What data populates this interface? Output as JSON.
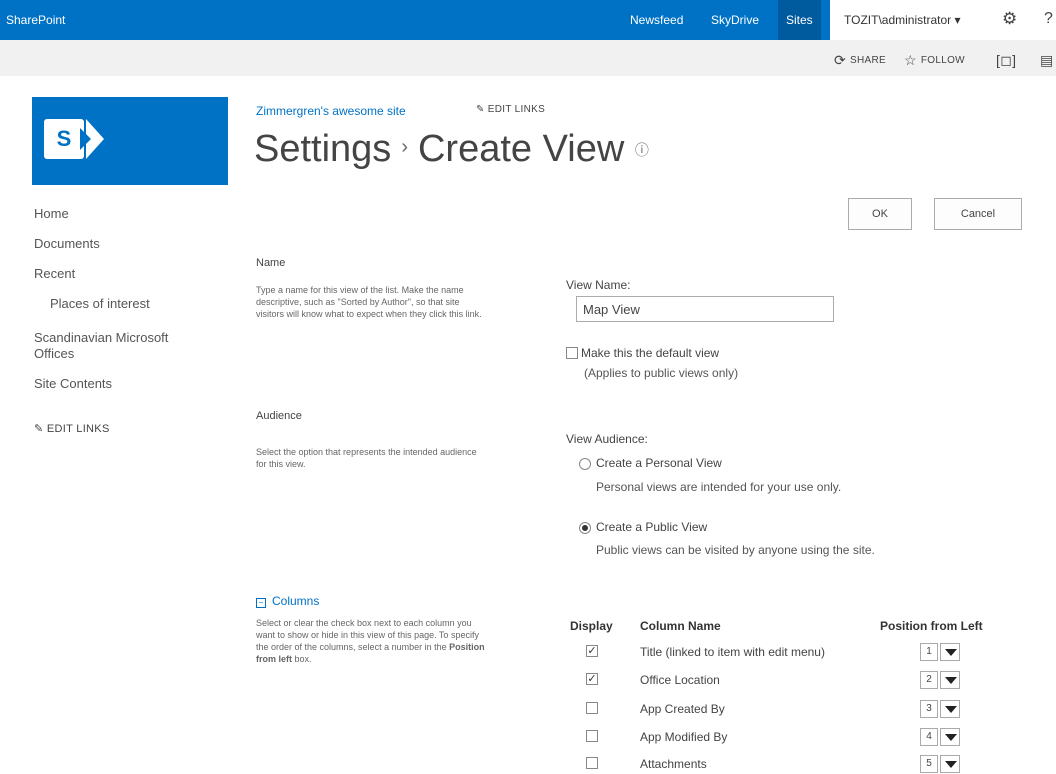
{
  "suite": {
    "brand": "SharePoint",
    "newsfeed": "Newsfeed",
    "skydrive": "SkyDrive",
    "sites": "Sites",
    "user": "TOZIT\\administrator ▾",
    "gear_icon": "gear-icon",
    "help": "?"
  },
  "ribbon": {
    "share": "SHARE",
    "follow": "FOLLOW",
    "focus_icon": "focus-icon",
    "extra_icon": "page-icon"
  },
  "header": {
    "site_link": "Zimmergren's awesome site",
    "edit_links": "EDIT LINKS",
    "title_part1": "Settings",
    "separator": "›",
    "title_part2": "Create View",
    "info": "ⓘ"
  },
  "nav": {
    "items": [
      "Home",
      "Documents",
      "Recent",
      "Places of interest",
      "Scandinavian Microsoft",
      "Offices",
      "Site Contents"
    ],
    "edit_links": "EDIT LINKS"
  },
  "buttons": {
    "ok": "OK",
    "cancel": "Cancel"
  },
  "name_section": {
    "title": "Name",
    "desc1": "Type a name for this view of the list. Make the name",
    "desc2": "descriptive, such as \"Sorted by Author\", so that site",
    "desc3": "visitors will know what to expect when they click this link.",
    "view_name_label": "View Name:",
    "view_name_value": "Map View",
    "default_label": "Make this the default view",
    "default_sub": "(Applies to public views only)"
  },
  "audience_section": {
    "title": "Audience",
    "desc1": "Select the option that represents the intended audience",
    "desc2": "for this view.",
    "label": "View Audience:",
    "personal": "Create a Personal View",
    "personal_sub": "Personal views are intended for your use only.",
    "public": "Create a Public View",
    "public_sub": "Public views can be visited by anyone using the site."
  },
  "columns_section": {
    "title": "Columns",
    "collapse_glyph": "−",
    "desc1": "Select or clear the check box next to each column you",
    "desc2": "want to show or hide in this view of this page. To specify",
    "desc3": "the order of the columns, select a number in the",
    "desc3_bold": "Position",
    "desc4_bold": "from left",
    "desc4": "box.",
    "headers": {
      "display": "Display",
      "name": "Column Name",
      "position": "Position from Left"
    },
    "check": "✓",
    "rows": [
      {
        "name": "Title (linked to item with edit menu)",
        "position": "1"
      },
      {
        "name": "Office Location",
        "position": "2"
      },
      {
        "name": "App Created By",
        "position": "3"
      },
      {
        "name": "App Modified By",
        "position": "4"
      },
      {
        "name": "Attachments",
        "position": "5"
      }
    ]
  }
}
